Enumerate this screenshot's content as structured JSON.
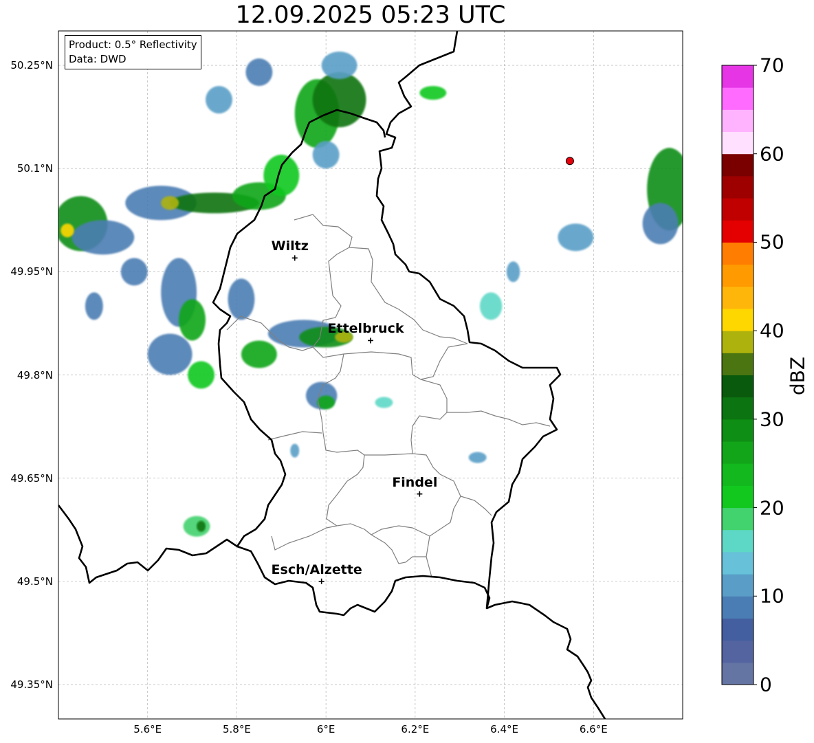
{
  "title": "12.09.2025 05:23 UTC",
  "info": {
    "product_line": "Product: 0.5° Reflectivity",
    "data_line": "Data: DWD"
  },
  "map": {
    "lon_range": [
      5.4,
      6.8
    ],
    "lat_range": [
      49.3,
      50.3
    ],
    "lat_ticks": [
      {
        "value": 50.25,
        "label": "50.25°N"
      },
      {
        "value": 50.1,
        "label": "50.1°N"
      },
      {
        "value": 49.95,
        "label": "49.95°N"
      },
      {
        "value": 49.8,
        "label": "49.8°N"
      },
      {
        "value": 49.65,
        "label": "49.65°N"
      },
      {
        "value": 49.5,
        "label": "49.5°N"
      },
      {
        "value": 49.35,
        "label": "49.35°N"
      }
    ],
    "lon_ticks": [
      {
        "value": 5.6,
        "label": "5.6°E"
      },
      {
        "value": 5.8,
        "label": "5.8°E"
      },
      {
        "value": 6.0,
        "label": "6°E"
      },
      {
        "value": 6.2,
        "label": "6.2°E"
      },
      {
        "value": 6.4,
        "label": "6.4°E"
      },
      {
        "value": 6.6,
        "label": "6.6°E"
      }
    ],
    "cities": [
      {
        "name": "Wiltz",
        "lon": 5.93,
        "lat": 49.97
      },
      {
        "name": "Ettelbruck",
        "lon": 6.1,
        "lat": 49.85
      },
      {
        "name": "Findel",
        "lon": 6.21,
        "lat": 49.627
      },
      {
        "name": "Esch/Alzette",
        "lon": 5.99,
        "lat": 49.5
      }
    ],
    "radar_site": {
      "lon": 6.547,
      "lat": 50.111,
      "color": "#e8000b"
    },
    "echo_cells": [
      {
        "lon": 5.45,
        "lat": 50.02,
        "rx": 0.06,
        "ry": 0.04,
        "dbz": 28
      },
      {
        "lon": 5.5,
        "lat": 50.0,
        "rx": 0.07,
        "ry": 0.025,
        "dbz": 8
      },
      {
        "lon": 5.42,
        "lat": 50.01,
        "rx": 0.015,
        "ry": 0.01,
        "dbz": 40
      },
      {
        "lon": 5.63,
        "lat": 50.05,
        "rx": 0.08,
        "ry": 0.025,
        "dbz": 8
      },
      {
        "lon": 5.75,
        "lat": 50.05,
        "rx": 0.1,
        "ry": 0.015,
        "dbz": 30
      },
      {
        "lon": 5.85,
        "lat": 50.06,
        "rx": 0.06,
        "ry": 0.02,
        "dbz": 25
      },
      {
        "lon": 5.65,
        "lat": 50.05,
        "rx": 0.02,
        "ry": 0.01,
        "dbz": 38
      },
      {
        "lon": 5.9,
        "lat": 50.09,
        "rx": 0.04,
        "ry": 0.03,
        "dbz": 22
      },
      {
        "lon": 5.98,
        "lat": 50.18,
        "rx": 0.05,
        "ry": 0.05,
        "dbz": 27
      },
      {
        "lon": 6.03,
        "lat": 50.2,
        "rx": 0.06,
        "ry": 0.04,
        "dbz": 30
      },
      {
        "lon": 6.03,
        "lat": 50.25,
        "rx": 0.04,
        "ry": 0.02,
        "dbz": 10
      },
      {
        "lon": 6.0,
        "lat": 50.12,
        "rx": 0.03,
        "ry": 0.02,
        "dbz": 10
      },
      {
        "lon": 5.67,
        "lat": 49.92,
        "rx": 0.04,
        "ry": 0.05,
        "dbz": 8
      },
      {
        "lon": 5.7,
        "lat": 49.88,
        "rx": 0.03,
        "ry": 0.03,
        "dbz": 25
      },
      {
        "lon": 5.57,
        "lat": 49.95,
        "rx": 0.03,
        "ry": 0.02,
        "dbz": 8
      },
      {
        "lon": 5.48,
        "lat": 49.9,
        "rx": 0.02,
        "ry": 0.02,
        "dbz": 8
      },
      {
        "lon": 5.65,
        "lat": 49.83,
        "rx": 0.05,
        "ry": 0.03,
        "dbz": 8
      },
      {
        "lon": 5.72,
        "lat": 49.8,
        "rx": 0.03,
        "ry": 0.02,
        "dbz": 22
      },
      {
        "lon": 5.81,
        "lat": 49.91,
        "rx": 0.03,
        "ry": 0.03,
        "dbz": 8
      },
      {
        "lon": 5.95,
        "lat": 49.86,
        "rx": 0.08,
        "ry": 0.02,
        "dbz": 8
      },
      {
        "lon": 6.0,
        "lat": 49.855,
        "rx": 0.06,
        "ry": 0.015,
        "dbz": 28
      },
      {
        "lon": 5.85,
        "lat": 49.83,
        "rx": 0.04,
        "ry": 0.02,
        "dbz": 25
      },
      {
        "lon": 6.04,
        "lat": 49.855,
        "rx": 0.02,
        "ry": 0.008,
        "dbz": 39
      },
      {
        "lon": 5.99,
        "lat": 49.77,
        "rx": 0.035,
        "ry": 0.02,
        "dbz": 8
      },
      {
        "lon": 6.0,
        "lat": 49.76,
        "rx": 0.02,
        "ry": 0.01,
        "dbz": 26
      },
      {
        "lon": 6.13,
        "lat": 49.76,
        "rx": 0.02,
        "ry": 0.008,
        "dbz": 16
      },
      {
        "lon": 5.71,
        "lat": 49.58,
        "rx": 0.03,
        "ry": 0.015,
        "dbz": 18
      },
      {
        "lon": 5.72,
        "lat": 49.58,
        "rx": 0.01,
        "ry": 0.008,
        "dbz": 32
      },
      {
        "lon": 6.56,
        "lat": 50.0,
        "rx": 0.04,
        "ry": 0.02,
        "dbz": 12
      },
      {
        "lon": 6.77,
        "lat": 50.07,
        "rx": 0.05,
        "ry": 0.06,
        "dbz": 28
      },
      {
        "lon": 6.75,
        "lat": 50.02,
        "rx": 0.04,
        "ry": 0.03,
        "dbz": 8
      },
      {
        "lon": 6.37,
        "lat": 49.9,
        "rx": 0.025,
        "ry": 0.02,
        "dbz": 16
      },
      {
        "lon": 6.24,
        "lat": 50.21,
        "rx": 0.03,
        "ry": 0.01,
        "dbz": 22
      },
      {
        "lon": 5.76,
        "lat": 50.2,
        "rx": 0.03,
        "ry": 0.02,
        "dbz": 10
      },
      {
        "lon": 5.85,
        "lat": 50.24,
        "rx": 0.03,
        "ry": 0.02,
        "dbz": 8
      },
      {
        "lon": 6.42,
        "lat": 49.95,
        "rx": 0.015,
        "ry": 0.015,
        "dbz": 10
      },
      {
        "lon": 6.34,
        "lat": 49.68,
        "rx": 0.02,
        "ry": 0.008,
        "dbz": 10
      },
      {
        "lon": 5.93,
        "lat": 49.69,
        "rx": 0.01,
        "ry": 0.01,
        "dbz": 10
      }
    ]
  },
  "colorbar": {
    "label": "dBZ",
    "min": 0,
    "max": 70,
    "ticks": [
      0,
      10,
      20,
      30,
      40,
      50,
      60,
      70
    ],
    "colors": [
      "#6474a3",
      "#5364a0",
      "#445fa0",
      "#4a7db3",
      "#5a9ec7",
      "#66c1d9",
      "#5ed8c6",
      "#42d26e",
      "#12c81f",
      "#12b81d",
      "#12a519",
      "#0e8e14",
      "#0c7411",
      "#0a5a0d",
      "#4a7510",
      "#aeb20c",
      "#ffd700",
      "#ffb60a",
      "#ff9a00",
      "#ff7d00",
      "#e40000",
      "#c00000",
      "#9e0000",
      "#7a0000",
      "#ffe0ff",
      "#ffb3ff",
      "#ff6bff",
      "#e535e5"
    ]
  }
}
